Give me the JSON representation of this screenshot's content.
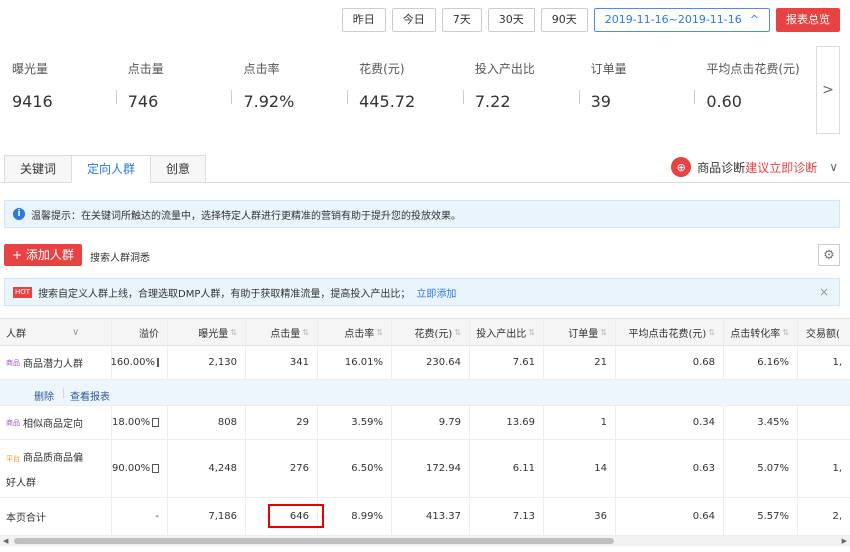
{
  "toolbar": {
    "yesterday": "昨日",
    "today": "今日",
    "d7": "7天",
    "d30": "30天",
    "d90": "90天",
    "date_range": "2019-11-16~2019-11-16",
    "report": "报表总览"
  },
  "metrics": [
    {
      "label": "曝光量",
      "value": "9416"
    },
    {
      "label": "点击量",
      "value": "746"
    },
    {
      "label": "点击率",
      "value": "7.92%"
    },
    {
      "label": "花费(元)",
      "value": "445.72"
    },
    {
      "label": "投入产出比",
      "value": "7.22"
    },
    {
      "label": "订单量",
      "value": "39"
    },
    {
      "label": "平均点击花费(元)",
      "value": "0.60"
    }
  ],
  "tabs": [
    "关键词",
    "定向人群",
    "创意"
  ],
  "diagnosis": {
    "label": "商品诊断",
    "link": "建议立即诊断"
  },
  "tip1": "温馨提示：在关键词所触达的流量中，选择特定人群进行更精准的营销有助于提升您的投放效果。",
  "tip2": {
    "hot": "HOT",
    "text": "搜索自定义人群上线，合理选取DMP人群，有助于获取精准流量，提高投入产出比；",
    "link": "立即添加"
  },
  "add_button": "+ 添加人群",
  "search_insight": "搜索人群洞悉",
  "table": {
    "headers": [
      "人群",
      "溢价",
      "曝光量",
      "点击量",
      "点击率",
      "花费(元)",
      "投入产出比",
      "订单量",
      "平均点击花费(元)",
      "点击转化率",
      "交易额("
    ],
    "rows": [
      {
        "tag": "商品",
        "name": "商品潜力人群",
        "premium": "160.00%",
        "impr": "2,130",
        "clicks": "341",
        "ctr": "16.01%",
        "cost": "230.64",
        "roi": "7.61",
        "orders": "21",
        "cpc": "0.68",
        "cvr": "6.16%",
        "gmv": "1,"
      },
      {
        "tag": "商品",
        "name": "相似商品定向",
        "premium": "18.00%",
        "impr": "808",
        "clicks": "29",
        "ctr": "3.59%",
        "cost": "9.79",
        "roi": "13.69",
        "orders": "1",
        "cpc": "0.34",
        "cvr": "3.45%",
        "gmv": ""
      },
      {
        "tag": "平台",
        "name": "商品质商品偏",
        "name2": "好人群",
        "premium": "90.00%",
        "impr": "4,248",
        "clicks": "276",
        "ctr": "6.50%",
        "cost": "172.94",
        "roi": "6.11",
        "orders": "14",
        "cpc": "0.63",
        "cvr": "5.07%",
        "gmv": "1,"
      }
    ],
    "actions": {
      "delete": "删除",
      "view": "查看报表"
    },
    "total": {
      "name": "本页合计",
      "premium": "-",
      "impr": "7,186",
      "clicks": "646",
      "ctr": "8.99%",
      "cost": "413.37",
      "roi": "7.13",
      "orders": "36",
      "cpc": "0.64",
      "cvr": "5.57%",
      "gmv": "2,"
    }
  }
}
